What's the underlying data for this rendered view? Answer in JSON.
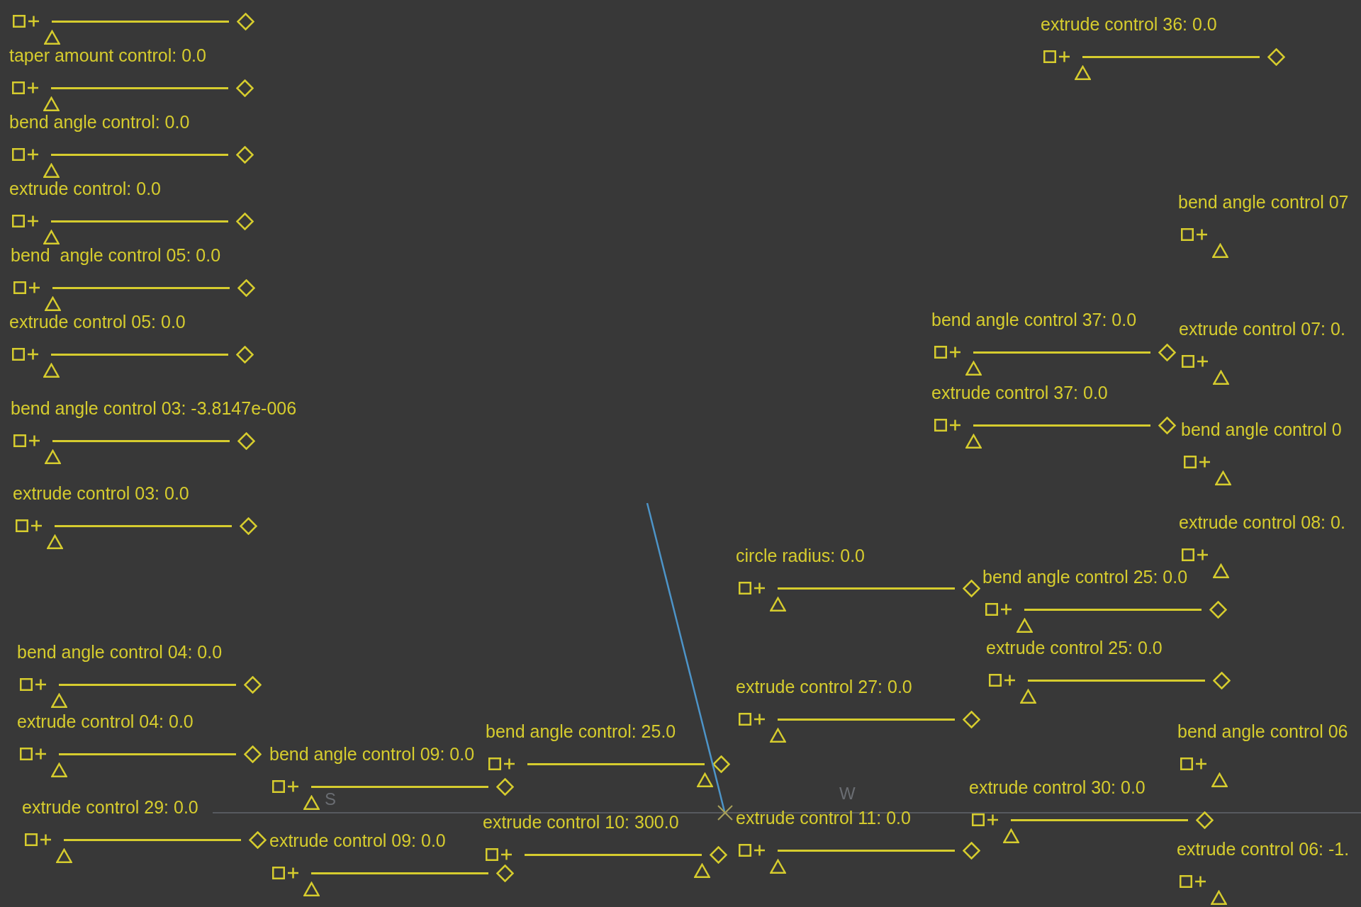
{
  "viewport": {
    "axis_labels": [
      "S",
      "W"
    ],
    "controls": [
      {
        "kind": "slider",
        "level": 0
      },
      {
        "kind": "slider",
        "label": "taper amount control: 0.0",
        "level": 0
      },
      {
        "kind": "slider",
        "label": "bend angle control: 0.0",
        "level": 0
      },
      {
        "kind": "slider",
        "label": "extrude control: 0.0",
        "level": 0
      },
      {
        "kind": "slider",
        "label": "bend  angle control 05: 0.0",
        "level": 0
      },
      {
        "kind": "slider",
        "label": "extrude control 05: 0.0",
        "level": 0
      },
      {
        "kind": "slider",
        "label": "bend angle control 03: -3.8147e-006",
        "level": 0
      },
      {
        "kind": "slider",
        "label": "extrude control 03: 0.0",
        "level": 0
      },
      {
        "kind": "slider",
        "label": "bend angle control 04: 0.0",
        "level": 0
      },
      {
        "kind": "slider",
        "label": "extrude control 04: 0.0",
        "level": 0
      },
      {
        "kind": "slider",
        "label": "extrude control 29: 0.0",
        "level": 0
      },
      {
        "kind": "slider",
        "label": "bend angle control 09: 0.0",
        "level": 0
      },
      {
        "kind": "slider",
        "label": "extrude control 09: 0.0",
        "level": 0
      },
      {
        "kind": "slider",
        "label": "bend angle control: 25.0",
        "level": 1
      },
      {
        "kind": "slider",
        "label": "extrude control 10: 300.0",
        "level": 1
      },
      {
        "kind": "slider",
        "label": "circle radius: 0.0",
        "level": 0
      },
      {
        "kind": "slider",
        "label": "extrude control 27: 0.0",
        "level": 0
      },
      {
        "kind": "slider",
        "label": "extrude control 11: 0.0",
        "level": 0
      },
      {
        "kind": "slider",
        "label": "extrude control 36: 0.0",
        "level": 0
      },
      {
        "kind": "handle",
        "label": "bend angle control 07"
      },
      {
        "kind": "slider",
        "label": "bend angle control 37: 0.0",
        "level": 0
      },
      {
        "kind": "handle",
        "label": "extrude control 07: 0."
      },
      {
        "kind": "slider",
        "label": "extrude control 37: 0.0",
        "level": 0
      },
      {
        "kind": "handle",
        "label": "bend angle control 0"
      },
      {
        "kind": "handle",
        "label": "extrude control 08: 0."
      },
      {
        "kind": "slider",
        "label": "bend angle control 25: 0.0",
        "level": 0
      },
      {
        "kind": "slider",
        "label": "extrude control 25: 0.0",
        "level": 0
      },
      {
        "kind": "handle",
        "label": "bend angle control 06"
      },
      {
        "kind": "slider",
        "label": "extrude control 30: 0.0",
        "level": 0
      },
      {
        "kind": "handle",
        "label": "extrude control 06: -1."
      }
    ]
  }
}
